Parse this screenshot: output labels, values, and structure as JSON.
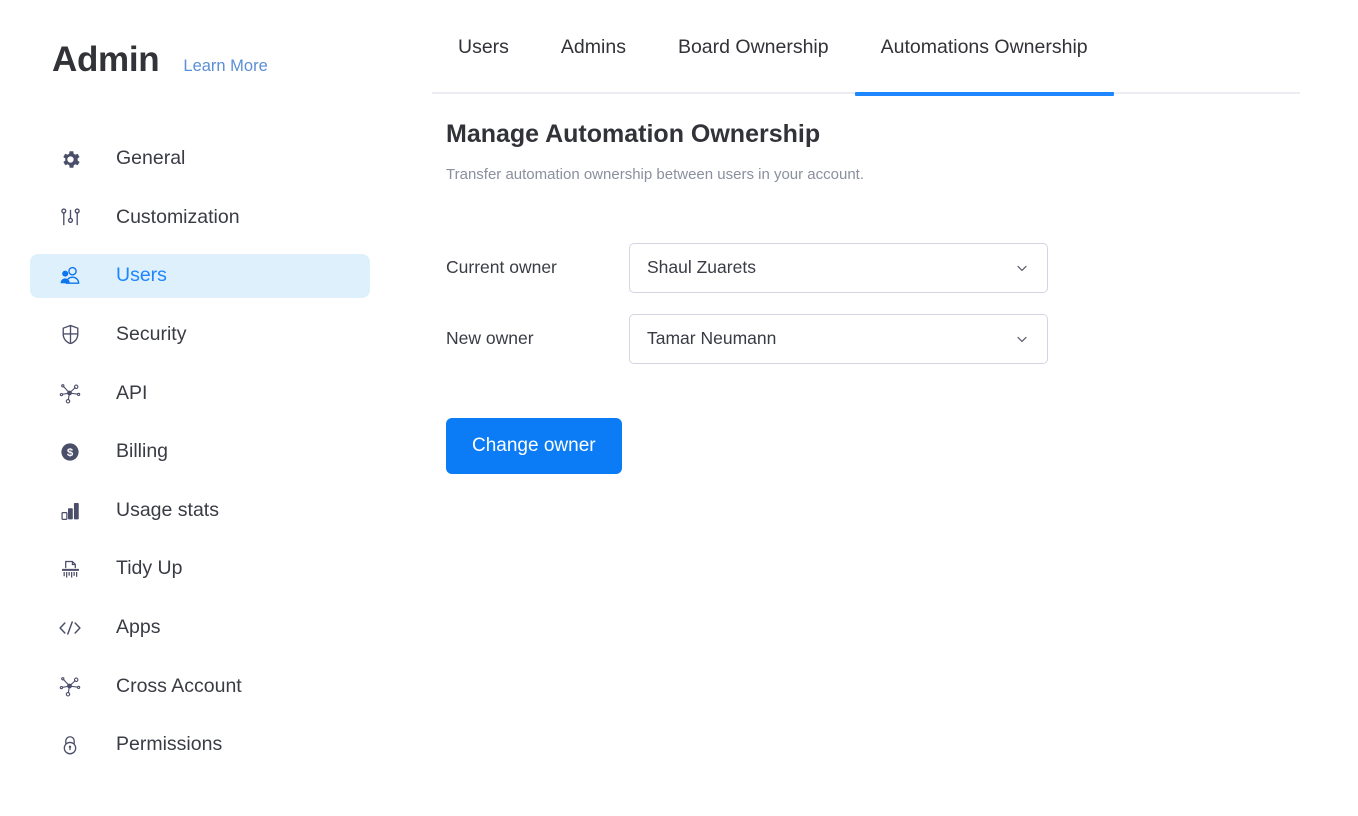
{
  "brand": {
    "title": "Admin",
    "learn_more": "Learn More"
  },
  "sidebar": {
    "items": [
      {
        "label": "General",
        "icon": "gear-icon",
        "active": false
      },
      {
        "label": "Customization",
        "icon": "sliders-icon",
        "active": false
      },
      {
        "label": "Users",
        "icon": "users-icon",
        "active": true
      },
      {
        "label": "Security",
        "icon": "shield-icon",
        "active": false
      },
      {
        "label": "API",
        "icon": "network-nodes-icon",
        "active": false
      },
      {
        "label": "Billing",
        "icon": "dollar-coin-icon",
        "active": false
      },
      {
        "label": "Usage stats",
        "icon": "bar-chart-icon",
        "active": false
      },
      {
        "label": "Tidy Up",
        "icon": "shredder-icon",
        "active": false
      },
      {
        "label": "Apps",
        "icon": "code-brackets-icon",
        "active": false
      },
      {
        "label": "Cross Account",
        "icon": "network-nodes-icon",
        "active": false
      },
      {
        "label": "Permissions",
        "icon": "lock-icon",
        "active": false
      }
    ]
  },
  "tabs": [
    {
      "label": "Users",
      "active": false
    },
    {
      "label": "Admins",
      "active": false
    },
    {
      "label": "Board Ownership",
      "active": false
    },
    {
      "label": "Automations Ownership",
      "active": true
    }
  ],
  "main": {
    "heading": "Manage Automation Ownership",
    "subtitle": "Transfer automation ownership between users in your account.",
    "form": {
      "current_owner": {
        "label": "Current owner",
        "value": "Shaul Zuarets",
        "chevron": "chevron-down-icon"
      },
      "new_owner": {
        "label": "New owner",
        "value": "Tamar Neumann",
        "chevron": "chevron-down-icon"
      },
      "submit_label": "Change owner"
    }
  },
  "colors": {
    "accent_blue": "#1e86ff",
    "button_blue": "#0b7cf5",
    "active_item_bg": "#dff0fd",
    "link_blue": "#5b8fd6",
    "text_dark": "#323338",
    "text_muted": "#8b8f9e",
    "border_gray": "#d3d6e2"
  }
}
